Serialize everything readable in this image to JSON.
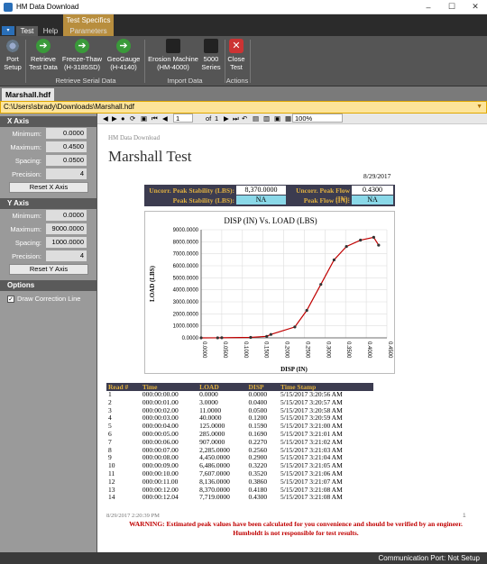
{
  "window": {
    "title": "HM Data Download",
    "minimize": "–",
    "maximize": "☐",
    "close": "✕"
  },
  "ribbon": {
    "context_tab": "Test Specifics",
    "file_label": "▾",
    "tabs": [
      "Test",
      "Help",
      "Parameters"
    ],
    "buttons": {
      "port_setup": "Port\nSetup",
      "retrieve_test_data": "Retrieve\nTest Data",
      "freeze_thaw": "Freeze-Thaw\n(H-3185SD)",
      "geogauge": "GeoGauge\n(H-4140)",
      "erosion_machine": "Erosion Machine\n(HM-4000)",
      "series_5000": "5000\nSeries",
      "close_test": "Close\nTest"
    },
    "groups": {
      "retrieve_serial": "Retrieve Serial Data",
      "import": "Import Data",
      "actions": "Actions"
    }
  },
  "doc_tab": {
    "label": "Marshall.hdf",
    "close": "✕"
  },
  "path": "C:\\Users\\sbrady\\Downloads\\Marshall.hdf",
  "left": {
    "x_axis": {
      "title": "X Axis",
      "minimum_label": "Minimum:",
      "minimum": "0.0000",
      "maximum_label": "Maximum:",
      "maximum": "0.4500",
      "spacing_label": "Spacing:",
      "spacing": "0.0500",
      "precision_label": "Precision:",
      "precision": "4",
      "reset": "Reset X Axis"
    },
    "y_axis": {
      "title": "Y Axis",
      "minimum_label": "Minimum:",
      "minimum": "0.0000",
      "maximum_label": "Maximum:",
      "maximum": "9000.0000",
      "spacing_label": "Spacing:",
      "spacing": "1000.0000",
      "precision_label": "Precision:",
      "precision": "4",
      "reset": "Reset Y Axis"
    },
    "options": {
      "title": "Options",
      "draw_correction": "Draw Correction Line",
      "checked": "✓"
    }
  },
  "viewer_toolbar": {
    "page": "1",
    "of_label": "of",
    "total": "1",
    "zoom": "100%"
  },
  "report": {
    "header": "HM Data Download",
    "title": "Marshall Test",
    "date": "8/29/2017",
    "peak": {
      "uncorr_stab_label": "Uncorr. Peak Stability (LBS):",
      "uncorr_stab": "8,370.0000",
      "stab_label": "Peak Stability (LBS):",
      "stab": "NA",
      "uncorr_flow_label": "Uncorr. Peak Flow (IN):",
      "uncorr_flow": "0.4300",
      "flow_label": "Peak Flow (IN):",
      "flow": "NA"
    },
    "columns": [
      "Read #",
      "Time",
      "LOAD",
      "DISP",
      "Time Stamp"
    ],
    "rows": [
      [
        "1",
        "000:00:00.00",
        "0.0000",
        "0.0000",
        "5/15/2017 3:20:56 AM"
      ],
      [
        "2",
        "000:00:01.00",
        "3.0000",
        "0.0400",
        "5/15/2017 3:20:57 AM"
      ],
      [
        "3",
        "000:00:02.00",
        "11.0000",
        "0.0500",
        "5/15/2017 3:20:58 AM"
      ],
      [
        "4",
        "000:00:03.00",
        "40.0000",
        "0.1200",
        "5/15/2017 3:20:59 AM"
      ],
      [
        "5",
        "000:00:04.00",
        "125.0000",
        "0.1590",
        "5/15/2017 3:21:00 AM"
      ],
      [
        "6",
        "000:00:05.00",
        "285.0000",
        "0.1690",
        "5/15/2017 3:21:01 AM"
      ],
      [
        "7",
        "000:00:06.00",
        "907.0000",
        "0.2270",
        "5/15/2017 3:21:02 AM"
      ],
      [
        "8",
        "000:00:07.00",
        "2,285.0000",
        "0.2560",
        "5/15/2017 3:21:03 AM"
      ],
      [
        "9",
        "000:00:08.00",
        "4,450.0000",
        "0.2900",
        "5/15/2017 3:21:04 AM"
      ],
      [
        "10",
        "000:00:09.00",
        "6,486.0000",
        "0.3220",
        "5/15/2017 3:21:05 AM"
      ],
      [
        "11",
        "000:00:10.00",
        "7,607.0000",
        "0.3520",
        "5/15/2017 3:21:06 AM"
      ],
      [
        "12",
        "000:00:11.00",
        "8,136.0000",
        "0.3860",
        "5/15/2017 3:21:07 AM"
      ],
      [
        "13",
        "000:00:12.00",
        "8,370.0000",
        "0.4180",
        "5/15/2017 3:21:08 AM"
      ],
      [
        "14",
        "000:00:12.04",
        "7,719.0000",
        "0.4300",
        "5/15/2017 3:21:08 AM"
      ]
    ],
    "footer_date": "8/29/2017 2:20:39 PM",
    "footer_page": "1",
    "warning_1": "WARNING: Estimated peak values have been calculated for you convenience and should be verified by an engineer.",
    "warning_2": "Humboldt is not responsible for test results."
  },
  "status": "Communication Port: Not Setup",
  "chart_data": {
    "type": "line",
    "title": "DISP (IN) Vs. LOAD (LBS)",
    "xlabel": "DISP (IN)",
    "ylabel": "LOAD (LBS)",
    "xlim": [
      0,
      0.45
    ],
    "ylim": [
      0,
      9000
    ],
    "x_ticks": [
      "0.0000",
      "0.0500",
      "0.1000",
      "0.1500",
      "0.2000",
      "0.2500",
      "0.3000",
      "0.3500",
      "0.4000",
      "0.4500"
    ],
    "y_ticks": [
      "0.0000",
      "1000.0000",
      "2000.0000",
      "3000.0000",
      "4000.0000",
      "5000.0000",
      "6000.0000",
      "7000.0000",
      "8000.0000",
      "9000.0000"
    ],
    "grid": true,
    "line_color": "#c00000",
    "x": [
      0,
      0.04,
      0.05,
      0.12,
      0.159,
      0.169,
      0.227,
      0.256,
      0.29,
      0.322,
      0.352,
      0.386,
      0.418,
      0.43
    ],
    "y": [
      0,
      3,
      11,
      40,
      125,
      285,
      907,
      2285,
      4450,
      6486,
      7607,
      8136,
      8370,
      7719
    ]
  }
}
